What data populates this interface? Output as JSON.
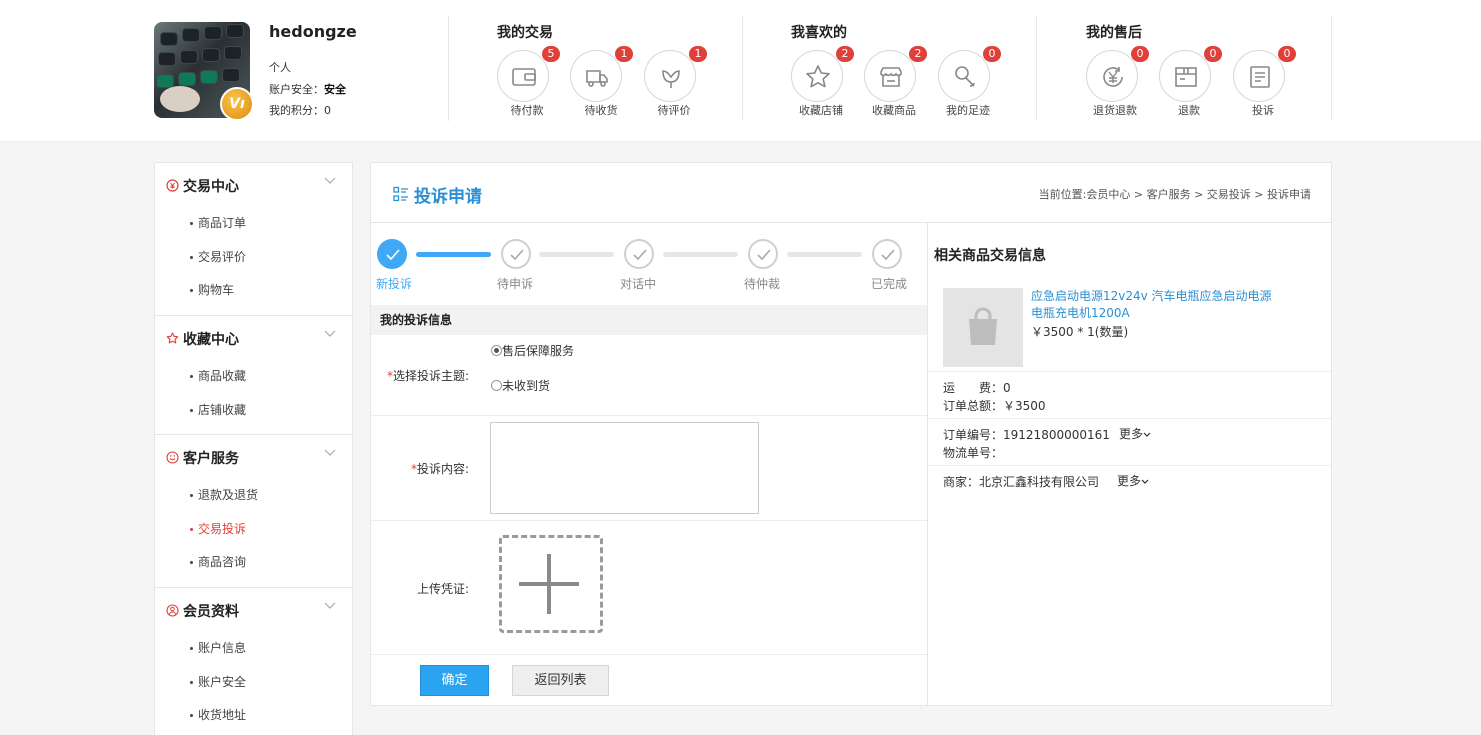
{
  "user": {
    "name": "hedongze",
    "type": "个人",
    "security_label": "账户安全：",
    "security_value": "安全",
    "points_label": "我的积分：",
    "points_value": "0",
    "badge": "Vı"
  },
  "header_groups": [
    {
      "title": "我的交易",
      "items": [
        {
          "label": "待付款",
          "count": "5",
          "icon": "wallet-icon"
        },
        {
          "label": "待收货",
          "count": "1",
          "icon": "truck-icon"
        },
        {
          "label": "待评价",
          "count": "1",
          "icon": "flower-icon"
        }
      ]
    },
    {
      "title": "我喜欢的",
      "items": [
        {
          "label": "收藏店铺",
          "count": "2",
          "icon": "star-icon"
        },
        {
          "label": "收藏商品",
          "count": "2",
          "icon": "store-icon"
        },
        {
          "label": "我的足迹",
          "count": "0",
          "icon": "footprint-icon"
        }
      ]
    },
    {
      "title": "我的售后",
      "items": [
        {
          "label": "退货退款",
          "count": "0",
          "icon": "yen-return-icon"
        },
        {
          "label": "退款",
          "count": "0",
          "icon": "box-icon"
        },
        {
          "label": "投诉",
          "count": "0",
          "icon": "document-icon"
        }
      ]
    }
  ],
  "sidebar": {
    "groups": [
      {
        "title": "交易中心",
        "icon": "yen-circle-icon",
        "items": [
          "商品订单",
          "交易评价",
          "购物车"
        ]
      },
      {
        "title": "收藏中心",
        "icon": "star-outline-icon",
        "items": [
          "商品收藏",
          "店铺收藏"
        ]
      },
      {
        "title": "客户服务",
        "icon": "smile-icon",
        "items": [
          "退款及退货",
          "交易投诉",
          "商品咨询"
        ]
      },
      {
        "title": "会员资料",
        "icon": "user-circle-icon",
        "items": [
          "账户信息",
          "账户安全",
          "收货地址"
        ]
      }
    ],
    "active_item": "交易投诉"
  },
  "main": {
    "title": "投诉申请",
    "breadcrumb": "当前位置:会员中心 > 客户服务 > 交易投诉 > 投诉申请",
    "steps": [
      {
        "label": "新投诉",
        "done": true
      },
      {
        "label": "待申诉",
        "done": false
      },
      {
        "label": "对话中",
        "done": false
      },
      {
        "label": "待仲裁",
        "done": false
      },
      {
        "label": "已完成",
        "done": false
      }
    ],
    "form": {
      "section_title": "我的投诉信息",
      "subject_label": "选择投诉主题:",
      "subject_options": [
        "售后保障服务",
        "未收到货"
      ],
      "subject_selected": "售后保障服务",
      "content_label": "投诉内容:",
      "content_value": "",
      "upload_label": "上传凭证:",
      "confirm_label": "确定",
      "back_label": "返回列表"
    }
  },
  "related": {
    "title": "相关商品交易信息",
    "product_name": "应急启动电源12v24v 汽车电瓶应急启动电源电瓶充电机1200A",
    "product_price": "￥3500 * 1(数量)",
    "shipping_label": "运　　费：",
    "shipping_value": "0",
    "total_label": "订单总额：",
    "total_value": "￥3500",
    "order_no_label": "订单编号：",
    "order_no_value": "19121800000161",
    "logistics_label": "物流单号：",
    "logistics_value": "",
    "more_label": "更多",
    "merchant_label": "商家：",
    "merchant_value": "北京汇鑫科技有限公司"
  },
  "colors": {
    "accent": "#2b8fd6",
    "step_done": "#3fa9f5",
    "badge": "#e0403a",
    "active_text": "#e0403a"
  }
}
